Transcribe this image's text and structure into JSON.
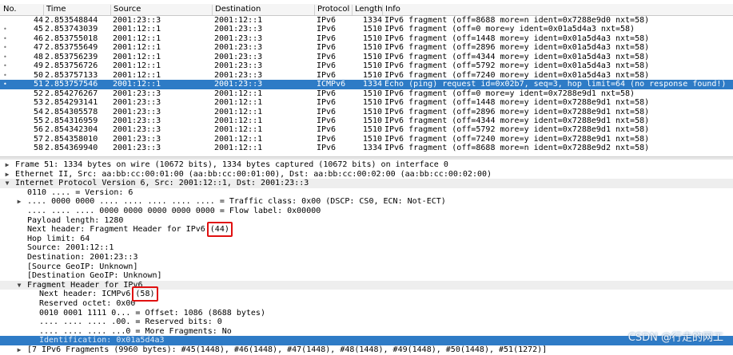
{
  "columns": {
    "no": "No.",
    "time": "Time",
    "source": "Source",
    "destination": "Destination",
    "protocol": "Protocol",
    "length": "Length",
    "info": "Info"
  },
  "packets": [
    {
      "no": "44",
      "time": "2.853548844",
      "src": "2001:23::3",
      "dst": "2001:12::1",
      "proto": "IPv6",
      "len": "1334",
      "info": "IPv6 fragment (off=8688 more=n ident=0x7288e9d0 nxt=58)",
      "mark": false,
      "selected": false
    },
    {
      "no": "45",
      "time": "2.853743039",
      "src": "2001:12::1",
      "dst": "2001:23::3",
      "proto": "IPv6",
      "len": "1510",
      "info": "IPv6 fragment (off=0 more=y ident=0x01a5d4a3 nxt=58)",
      "mark": true,
      "selected": false
    },
    {
      "no": "46",
      "time": "2.853755018",
      "src": "2001:12::1",
      "dst": "2001:23::3",
      "proto": "IPv6",
      "len": "1510",
      "info": "IPv6 fragment (off=1448 more=y ident=0x01a5d4a3 nxt=58)",
      "mark": true,
      "selected": false
    },
    {
      "no": "47",
      "time": "2.853755649",
      "src": "2001:12::1",
      "dst": "2001:23::3",
      "proto": "IPv6",
      "len": "1510",
      "info": "IPv6 fragment (off=2896 more=y ident=0x01a5d4a3 nxt=58)",
      "mark": true,
      "selected": false
    },
    {
      "no": "48",
      "time": "2.853756239",
      "src": "2001:12::1",
      "dst": "2001:23::3",
      "proto": "IPv6",
      "len": "1510",
      "info": "IPv6 fragment (off=4344 more=y ident=0x01a5d4a3 nxt=58)",
      "mark": true,
      "selected": false
    },
    {
      "no": "49",
      "time": "2.853756726",
      "src": "2001:12::1",
      "dst": "2001:23::3",
      "proto": "IPv6",
      "len": "1510",
      "info": "IPv6 fragment (off=5792 more=y ident=0x01a5d4a3 nxt=58)",
      "mark": true,
      "selected": false
    },
    {
      "no": "50",
      "time": "2.853757133",
      "src": "2001:12::1",
      "dst": "2001:23::3",
      "proto": "IPv6",
      "len": "1510",
      "info": "IPv6 fragment (off=7240 more=y ident=0x01a5d4a3 nxt=58)",
      "mark": true,
      "selected": false
    },
    {
      "no": "51",
      "time": "2.853757546",
      "src": "2001:12::1",
      "dst": "2001:23::3",
      "proto": "ICMPv6",
      "len": "1334",
      "info": "Echo (ping) request id=0x02b7, seq=3, hop limit=64 (no response found!)",
      "mark": true,
      "selected": true
    },
    {
      "no": "52",
      "time": "2.854276267",
      "src": "2001:23::3",
      "dst": "2001:12::1",
      "proto": "IPv6",
      "len": "1510",
      "info": "IPv6 fragment (off=0 more=y ident=0x7288e9d1 nxt=58)",
      "mark": false,
      "selected": false
    },
    {
      "no": "53",
      "time": "2.854293141",
      "src": "2001:23::3",
      "dst": "2001:12::1",
      "proto": "IPv6",
      "len": "1510",
      "info": "IPv6 fragment (off=1448 more=y ident=0x7288e9d1 nxt=58)",
      "mark": false,
      "selected": false
    },
    {
      "no": "54",
      "time": "2.854305578",
      "src": "2001:23::3",
      "dst": "2001:12::1",
      "proto": "IPv6",
      "len": "1510",
      "info": "IPv6 fragment (off=2896 more=y ident=0x7288e9d1 nxt=58)",
      "mark": false,
      "selected": false
    },
    {
      "no": "55",
      "time": "2.854316959",
      "src": "2001:23::3",
      "dst": "2001:12::1",
      "proto": "IPv6",
      "len": "1510",
      "info": "IPv6 fragment (off=4344 more=y ident=0x7288e9d1 nxt=58)",
      "mark": false,
      "selected": false
    },
    {
      "no": "56",
      "time": "2.854342304",
      "src": "2001:23::3",
      "dst": "2001:12::1",
      "proto": "IPv6",
      "len": "1510",
      "info": "IPv6 fragment (off=5792 more=y ident=0x7288e9d1 nxt=58)",
      "mark": false,
      "selected": false
    },
    {
      "no": "57",
      "time": "2.854358010",
      "src": "2001:23::3",
      "dst": "2001:12::1",
      "proto": "IPv6",
      "len": "1510",
      "info": "IPv6 fragment (off=7240 more=y ident=0x7288e9d1 nxt=58)",
      "mark": false,
      "selected": false
    },
    {
      "no": "58",
      "time": "2.854369940",
      "src": "2001:23::3",
      "dst": "2001:12::1",
      "proto": "IPv6",
      "len": "1334",
      "info": "IPv6 fragment (off=8688 more=n ident=0x7288e9d2 nxt=58)",
      "mark": false,
      "selected": false
    }
  ],
  "details": [
    {
      "text": "Frame 51: 1334 bytes on wire (10672 bits), 1334 bytes captured (10672 bits) on interface 0",
      "indent": 0,
      "toggle": "collapsed",
      "style": ""
    },
    {
      "text": "Ethernet II, Src: aa:bb:cc:00:01:00 (aa:bb:cc:00:01:00), Dst: aa:bb:cc:00:02:00 (aa:bb:cc:00:02:00)",
      "indent": 0,
      "toggle": "collapsed",
      "style": ""
    },
    {
      "text": "Internet Protocol Version 6, Src: 2001:12::1, Dst: 2001:23::3",
      "indent": 0,
      "toggle": "expanded",
      "style": "sec"
    },
    {
      "text": "0110 .... = Version: 6",
      "indent": 1,
      "toggle": "",
      "style": ""
    },
    {
      "text": ".... 0000 0000 .... .... .... .... .... = Traffic class: 0x00 (DSCP: CS0, ECN: Not-ECT)",
      "indent": 1,
      "toggle": "collapsed",
      "style": ""
    },
    {
      "text": ".... .... .... 0000 0000 0000 0000 0000 = Flow label: 0x00000",
      "indent": 1,
      "toggle": "",
      "style": ""
    },
    {
      "text": "Payload length: 1280",
      "indent": 1,
      "toggle": "",
      "style": ""
    },
    {
      "text": "Next header: Fragment Header for IPv6 (44)",
      "indent": 1,
      "toggle": "",
      "style": "",
      "box": "(44)"
    },
    {
      "text": "Hop limit: 64",
      "indent": 1,
      "toggle": "",
      "style": ""
    },
    {
      "text": "Source: 2001:12::1",
      "indent": 1,
      "toggle": "",
      "style": ""
    },
    {
      "text": "Destination: 2001:23::3",
      "indent": 1,
      "toggle": "",
      "style": ""
    },
    {
      "text": "[Source GeoIP: Unknown]",
      "indent": 1,
      "toggle": "",
      "style": ""
    },
    {
      "text": "[Destination GeoIP: Unknown]",
      "indent": 1,
      "toggle": "",
      "style": ""
    },
    {
      "text": "Fragment Header for IPv6",
      "indent": 1,
      "toggle": "expanded",
      "style": "sec"
    },
    {
      "text": "Next header: ICMPv6 (58)",
      "indent": 2,
      "toggle": "",
      "style": "",
      "box": "(58)"
    },
    {
      "text": "Reserved octet: 0x00",
      "indent": 2,
      "toggle": "",
      "style": ""
    },
    {
      "text": "0010 0001 1111 0... = Offset: 1086 (8688 bytes)",
      "indent": 2,
      "toggle": "",
      "style": ""
    },
    {
      "text": ".... .... .... .00. = Reserved bits: 0",
      "indent": 2,
      "toggle": "",
      "style": ""
    },
    {
      "text": ".... .... .... ...0 = More Fragments: No",
      "indent": 2,
      "toggle": "",
      "style": ""
    },
    {
      "text": "Identification: 0x01a5d4a3",
      "indent": 2,
      "toggle": "",
      "style": "hl"
    },
    {
      "text": "[7 IPv6 Fragments (9960 bytes): #45(1448), #46(1448), #47(1448), #48(1448), #49(1448), #50(1448), #51(1272)]",
      "indent": 1,
      "toggle": "collapsed",
      "style": ""
    }
  ],
  "watermark": "CSDN @行走的网工",
  "colors": {
    "selection": "#2e7bc6",
    "highlight_box": "#e01010"
  }
}
